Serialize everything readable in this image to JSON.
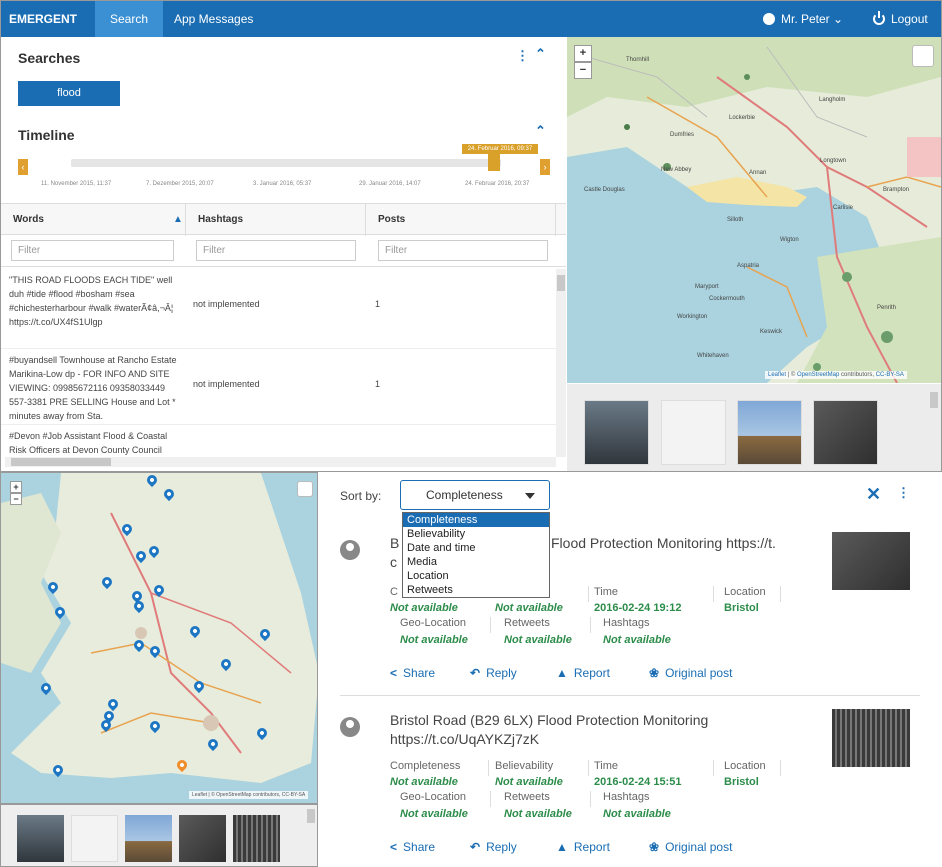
{
  "navbar": {
    "brand": "EMERGENT",
    "tabs": [
      "Search",
      "App Messages"
    ],
    "active_tab": "Search",
    "user": "Mr. Peter ⌄",
    "logout": "Logout"
  },
  "searches": {
    "title": "Searches",
    "chips": [
      "flood"
    ]
  },
  "timeline": {
    "title": "Timeline",
    "selected_label": "24. Februar 2016, 09:37",
    "ticks": [
      "11. November 2015, 11:37",
      "7. Dezember 2015, 20:07",
      "3. Januar 2016, 05:37",
      "29. Januar 2016, 14:07",
      "24. Februar 2016, 20:37"
    ]
  },
  "grid": {
    "columns": [
      "Words",
      "Hashtags",
      "Posts"
    ],
    "filter_placeholder": "Filter",
    "rows": [
      {
        "words": "\"THIS ROAD FLOODS EACH TIDE\" well duh #tide #flood #bosham #sea #chichesterharbour #walk #waterÃ¢â,¬Â¦ https://t.co/UX4fS1Ulgp",
        "hashtags": "not implemented",
        "posts": "1"
      },
      {
        "words": "#buyandsell Townhouse at Rancho Estate Marikina-Low dp - FOR INFO AND SITE VIEWING: 09985672116 09358033449 557-3381 PRE SELLING House and Lot * minutes away from Sta.",
        "hashtags": "not implemented",
        "posts": "1"
      },
      {
        "words": "#Devon #Job Assistant Flood & Coastal Risk Officers at Devon County Council",
        "hashtags": "",
        "posts": ""
      }
    ]
  },
  "map_top": {
    "places": [
      "Thornhill",
      "Langholm",
      "Lockerbie",
      "Dumfries",
      "Annan",
      "Longtown",
      "New Abbey",
      "Brampton",
      "Castle Douglas",
      "Carlisle",
      "Silloth",
      "Wigton",
      "Aspatria",
      "Maryport",
      "Cockermouth",
      "Workington",
      "Penrith",
      "Keswick",
      "Whitehaven"
    ],
    "attribution_link1": "Leaflet",
    "attribution_mid": " | © ",
    "attribution_link2": "OpenStreetMap",
    "attribution_tail": " contributors, ",
    "attribution_link3": "CC-BY-SA",
    "zoom_in": "+",
    "zoom_out": "−"
  },
  "map_bottom": {
    "attribution": "Leaflet | © OpenStreetMap contributors, CC-BY-SA",
    "zoom_in": "+",
    "zoom_out": "−"
  },
  "sort": {
    "label": "Sort by:",
    "selected": "Completeness",
    "options": [
      "Completeness",
      "Believability",
      "Date and time",
      "Media",
      "Location",
      "Retweets"
    ]
  },
  "labels": {
    "completeness": "Completeness",
    "believability": "Believability",
    "time": "Time",
    "location": "Location",
    "geo_location": "Geo-Location",
    "retweets": "Retweets",
    "hashtags": "Hashtags",
    "share": "Share",
    "reply": "Reply",
    "report": "Report",
    "original_post": "Original post"
  },
  "results": [
    {
      "title": "Bristol Road (B29 6LX) Flood Protection Monitoring https://t.co/UqAYKZj7zK",
      "title_visible_start": "B",
      "title_visible_start2": "c",
      "title_visible_end": "Flood Protection Monitoring https://t.",
      "completeness_partial": "C",
      "believability_partial": "ity",
      "completeness": "Not available",
      "believability": "Not available",
      "time": "2016-02-24 19:12",
      "location": "Bristol",
      "geo_location": "Not available",
      "retweets": "Not available",
      "hashtags": "Not available"
    },
    {
      "title": "Bristol Road (B29 6LX) Flood Protection Monitoring https://t.co/UqAYKZj7zK",
      "completeness": "Not available",
      "believability": "Not available",
      "time": "2016-02-24 15:51",
      "location": "Bristol",
      "geo_location": "Not available",
      "retweets": "Not available",
      "hashtags": "Not available"
    }
  ],
  "colors": {
    "primary": "#1a6db3",
    "accent": "#d9a02a",
    "value_green": "#2c8c4a",
    "orange_pin": "#f08c2a"
  }
}
